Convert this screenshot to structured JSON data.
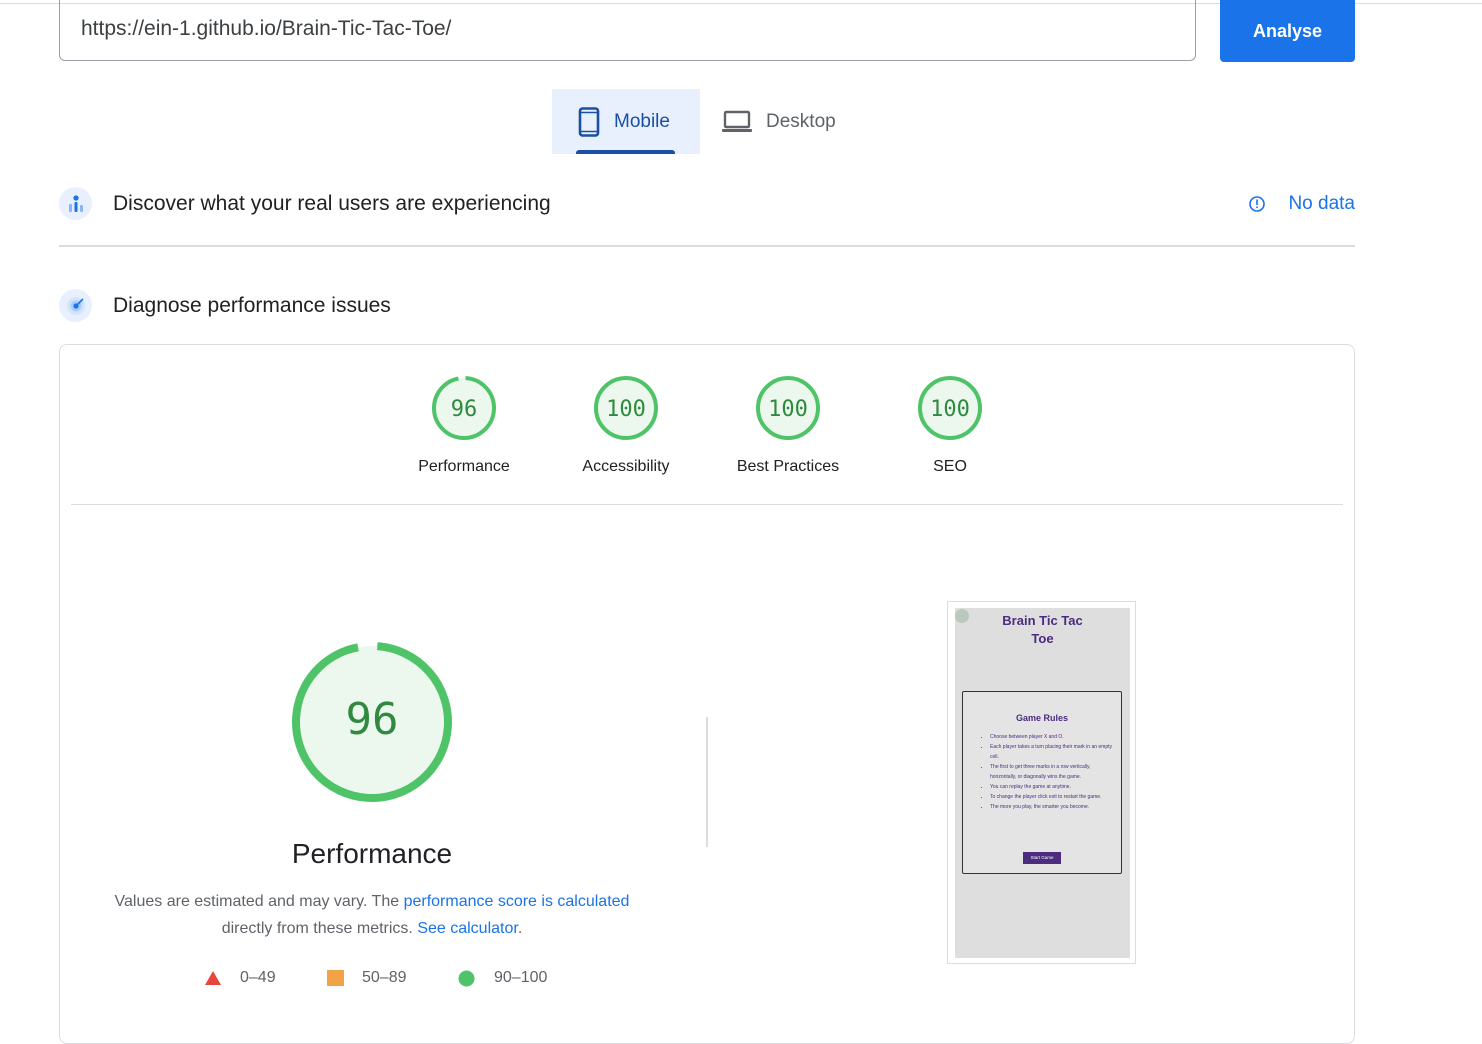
{
  "search": {
    "url": "https://ein-1.github.io/Brain-Tic-Tac-Toe/",
    "analyse_label": "Analyse"
  },
  "tabs": [
    {
      "label": "Mobile",
      "icon": "phone-icon",
      "active": true
    },
    {
      "label": "Desktop",
      "icon": "laptop-icon",
      "active": false
    }
  ],
  "field_data": {
    "title": "Discover what your real users are experiencing",
    "status": "No data"
  },
  "diagnose": {
    "title": "Diagnose performance issues"
  },
  "scores": [
    {
      "label": "Performance",
      "value": "96"
    },
    {
      "label": "Accessibility",
      "value": "100"
    },
    {
      "label": "Best Practices",
      "value": "100"
    },
    {
      "label": "SEO",
      "value": "100"
    }
  ],
  "performance": {
    "score": "96",
    "title": "Performance",
    "note_prefix": "Values are estimated and may vary. The ",
    "note_link1": "performance score is calculated",
    "note_middle": "directly from these metrics. ",
    "note_link2": "See calculator",
    "note_suffix": "."
  },
  "legend": [
    {
      "range": "0–49",
      "shape": "triangle",
      "color": "#e8453c"
    },
    {
      "range": "50–89",
      "shape": "square",
      "color": "#f0a443"
    },
    {
      "range": "90–100",
      "shape": "circle",
      "color": "#4fc367"
    }
  ],
  "screenshot": {
    "title_line1": "Brain Tic Tac",
    "title_line2": "Toe",
    "rules_title": "Game Rules",
    "rules": [
      "Choose between player X and O.",
      "Each player takes a turn placing their mark in an empty cell.",
      "The first to get three marks in a row vertically, horizontally, or diagonally wins the game.",
      "You can replay the game at anytime.",
      "To change the player click exit to restart the game.",
      "The more you play, the smarter you become."
    ],
    "button_label": "Start Game"
  },
  "colors": {
    "accent": "#1a73e8",
    "good": "#4fc367",
    "good_text": "#2f8a3f"
  }
}
